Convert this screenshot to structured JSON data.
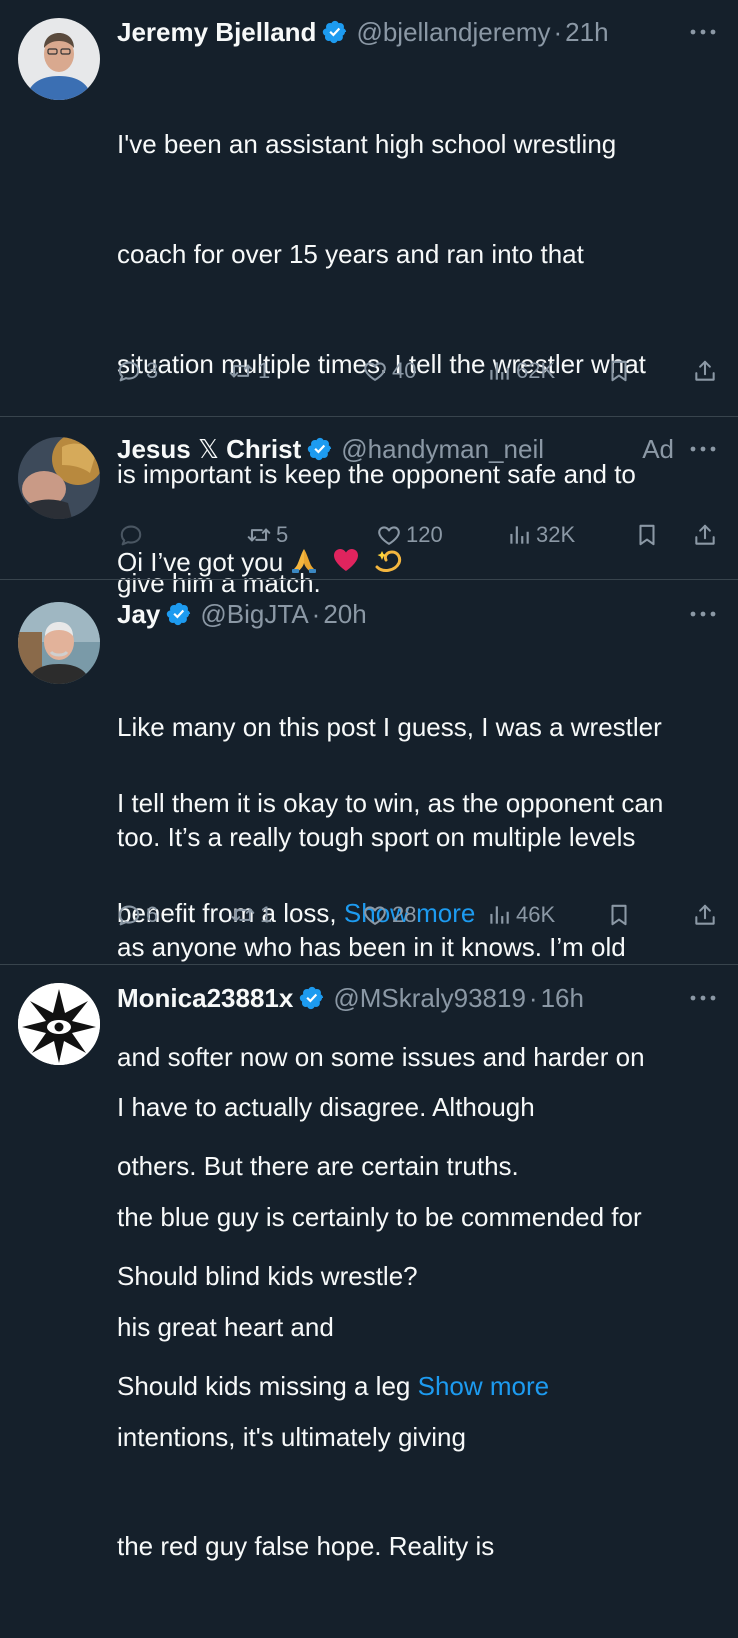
{
  "tweets": [
    {
      "name": "Jeremy Bjelland",
      "handle": "@bjellandjeremy",
      "time": "21h",
      "lines": [
        "I've been an assistant high school wrestling",
        "coach for over 15 years and ran into that",
        "situation multiple times.  I tell the wrestler what",
        "is important is keep the opponent safe and to",
        "give him a match.",
        "",
        "I tell them it is okay to win, as the opponent can"
      ],
      "last_line": "benefit from a loss, ",
      "show_more": "Show more",
      "replies": "3",
      "retweets": "1",
      "likes": "40",
      "views": "62K"
    },
    {
      "name": "Jesus ",
      "name_x": "𝕏",
      "name_end": " Christ",
      "handle": "@handyman_neil",
      "ad_label": "Ad",
      "text": "Oi I’ve got you",
      "replies": "",
      "retweets": "5",
      "likes": "120",
      "views": "32K"
    },
    {
      "name": "Jay",
      "handle": "@BigJTA",
      "time": "20h",
      "lines": [
        "Like many on this post I guess, I was a wrestler",
        "too. It’s a really tough sport on multiple levels",
        "as anyone who has been in it knows. I’m old",
        "and softer now on some issues and harder on",
        "others. But there are certain truths.",
        "Should blind kids wrestle?"
      ],
      "last_line": "Should kids missing a leg ",
      "show_more": "Show more",
      "replies": "6",
      "retweets": "1",
      "likes": "28",
      "views": "46K"
    },
    {
      "name": "Monica23881x",
      "handle": "@MSkraly93819",
      "time": "16h",
      "lines": [
        "I have to actually disagree. Although",
        "the blue guy is certainly to be commended for",
        "his great heart and",
        "intentions, it's ultimately giving",
        "the red guy false hope. Reality is"
      ]
    }
  ],
  "colors": {
    "background": "#15202b",
    "text": "#f7f9f9",
    "muted": "#8b98a5",
    "link": "#1d9bf0",
    "divider": "#38444d"
  },
  "icons": [
    "verified-badge-icon",
    "more-options-icon",
    "reply-icon",
    "retweet-icon",
    "like-icon",
    "views-icon",
    "bookmark-icon",
    "share-icon",
    "folded-hands-emoji",
    "red-heart-emoji",
    "dizzy-emoji"
  ]
}
